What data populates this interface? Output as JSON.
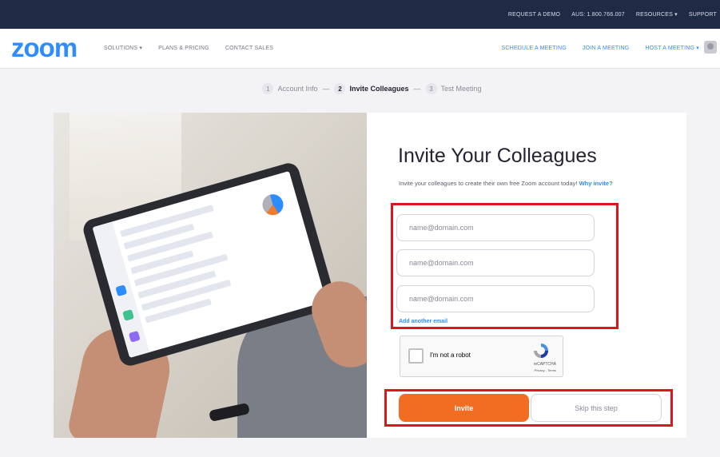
{
  "topbar": {
    "links": [
      "REQUEST A DEMO",
      "AUS: 1.800.766.007",
      "RESOURCES ▾",
      "SUPPORT"
    ]
  },
  "header": {
    "logo": "zoom",
    "nav_left": [
      "SOLUTIONS ▾",
      "PLANS & PRICING",
      "CONTACT SALES"
    ],
    "nav_right": [
      "SCHEDULE A MEETING",
      "JOIN A MEETING",
      "HOST A MEETING ▾"
    ]
  },
  "steps": [
    {
      "num": "1",
      "label": "Account Info"
    },
    {
      "num": "2",
      "label": "Invite Colleagues"
    },
    {
      "num": "3",
      "label": "Test Meeting"
    }
  ],
  "step_separator": "—",
  "form": {
    "title": "Invite Your Colleagues",
    "subtitle": "Invite your colleagues to create their own free Zoom account today!",
    "why_link": "Why invite?",
    "email_placeholder": "name@domain.com",
    "add_email": "Add another email",
    "recaptcha": {
      "label": "I'm not a robot",
      "brand": "reCAPTCHA",
      "privacy": "Privacy - Terms"
    },
    "invite_label": "Invite",
    "skip_label": "Skip this step"
  },
  "colors": {
    "topbar": "#1f2a44",
    "brand_blue": "#2d8cff",
    "invite_orange": "#f26d21",
    "highlight_red": "#e0141e"
  }
}
